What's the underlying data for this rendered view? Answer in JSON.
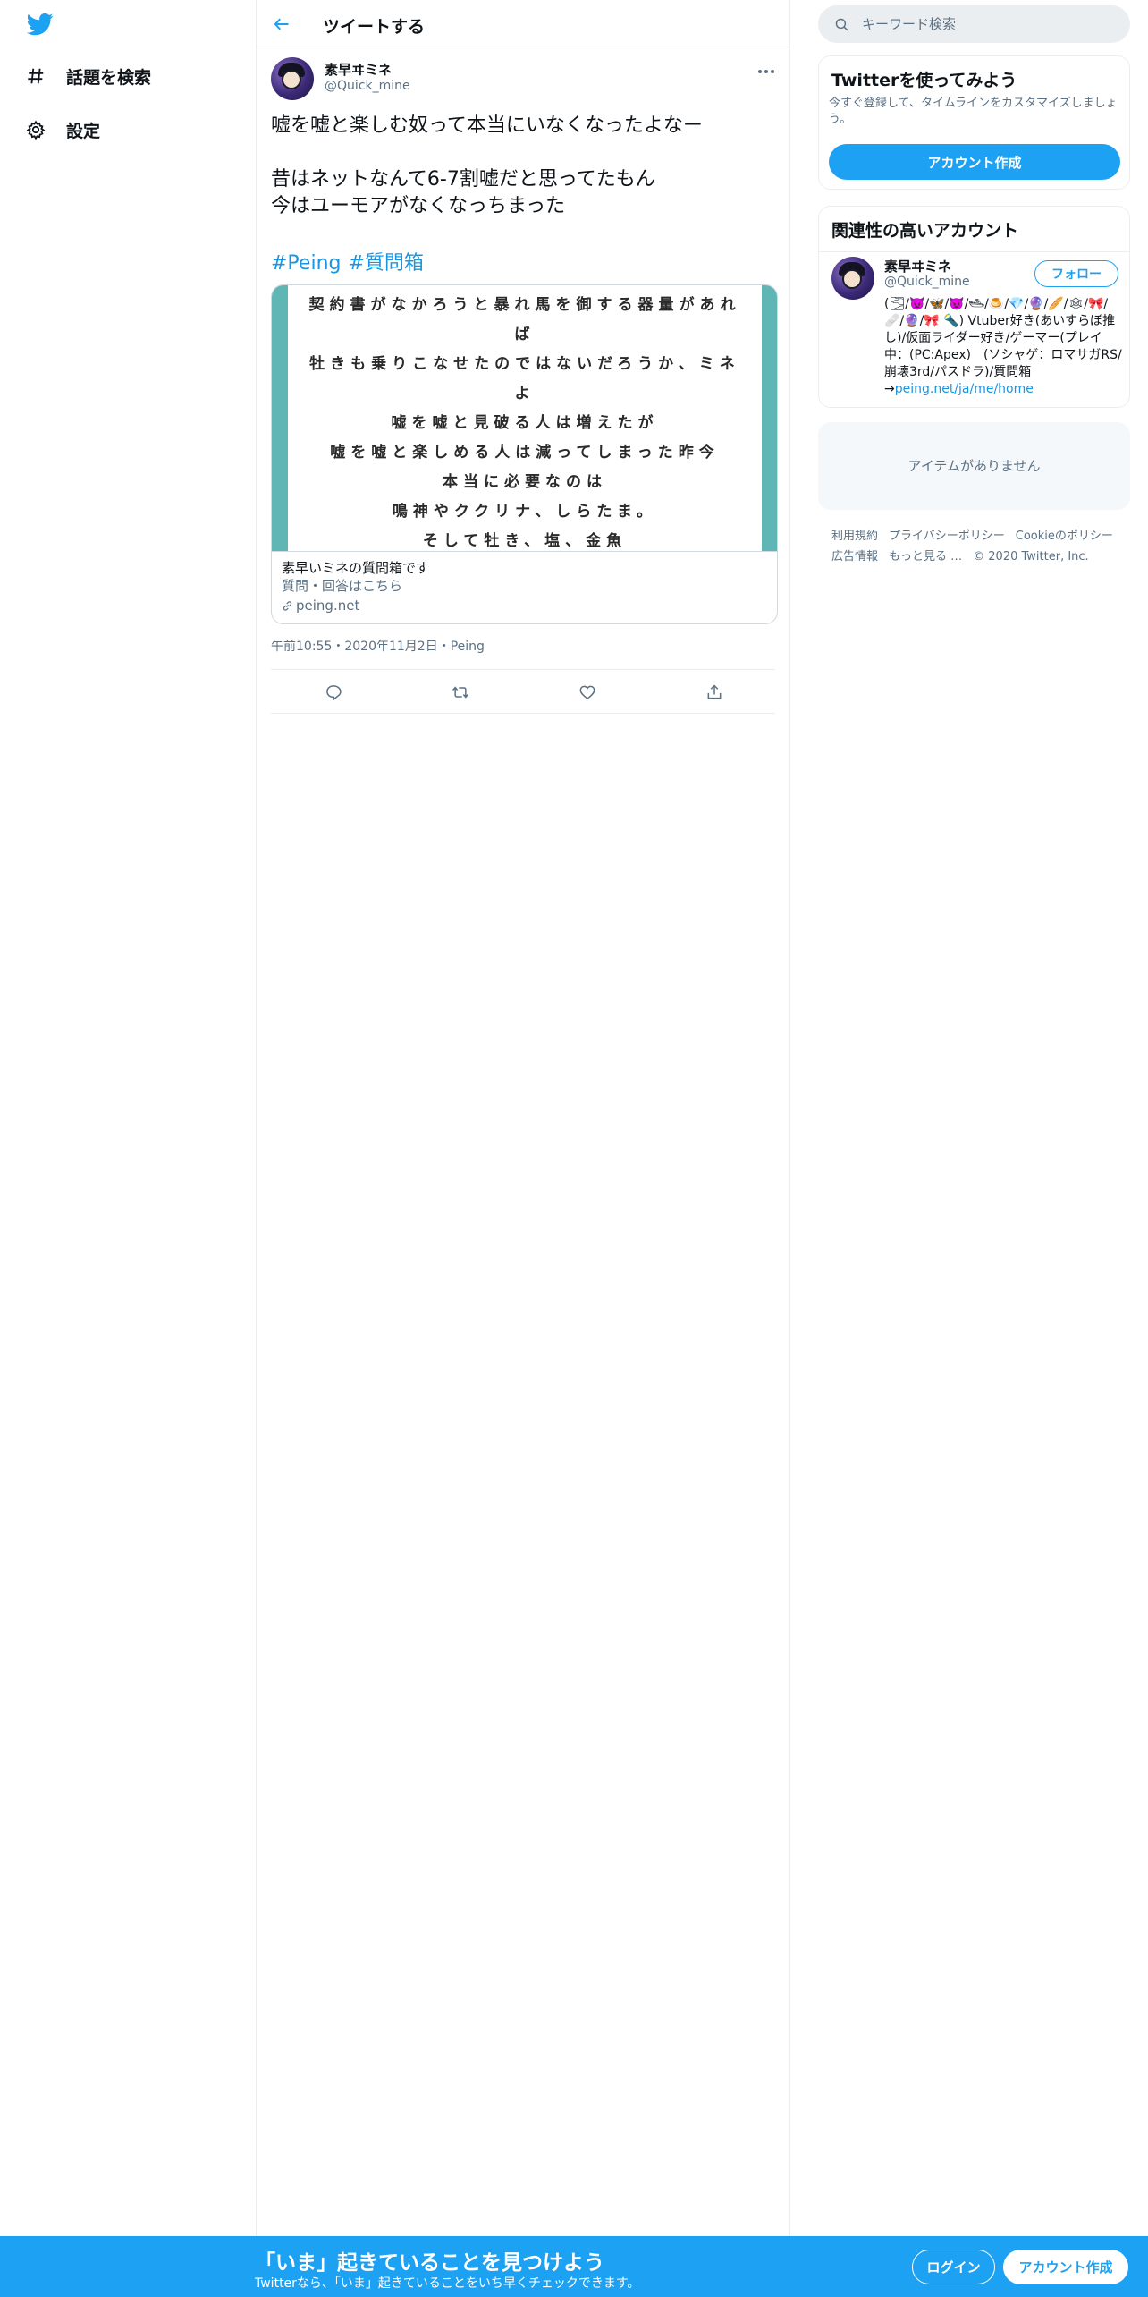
{
  "nav": {
    "logo_icon": "twitter-bird-icon",
    "explore_label": "話題を検索",
    "settings_label": "設定"
  },
  "header": {
    "title": "ツイートする"
  },
  "tweet": {
    "author_name": "素早ヰミネ",
    "author_handle": "@Quick_mine",
    "lines": [
      "嘘を嘘と楽しむ奴って本当にいなくなったよなー",
      "昔はネットなんて6-7割嘘だと思ってたもん",
      "今はユーモアがなくなっちまった"
    ],
    "hashtags": [
      "#Peing",
      "#質問箱"
    ],
    "timestamp": "午前10:55・2020年11月2日・Peing"
  },
  "card": {
    "image_lines": [
      "契約書がなかろうと暴れ馬を御する器量があれ",
      "ば",
      "牡きも乗りこなせたのではないだろうか、ミネ",
      "よ",
      "嘘を嘘と見破る人は増えたが",
      "嘘を嘘と楽しめる人は減ってしまった昨今",
      "本当に必要なのは",
      "鳴神やククリナ、しらたま。",
      "そして牡き、塩、金魚"
    ],
    "title": "素早いミネの質問箱です",
    "description": "質問・回答はこちら",
    "domain": "peing.net"
  },
  "search": {
    "placeholder": "キーワード検索"
  },
  "signup_panel": {
    "title": "Twitterを使ってみよう",
    "description": "今すぐ登録して、タイムラインをカスタマイズしましょう。",
    "button": "アカウント作成"
  },
  "related": {
    "title": "関連性の高いアカウント",
    "name": "素早ヰミネ",
    "handle": "@Quick_mine",
    "follow": "フォロー",
    "bio": "(🌫/👿/🦋/👿/🛥/🍮/💎/🔮/🥖/🕸/🎀/🩹/🔮/🎀 🔦) Vtuber好き(あいすらぼ推し)/仮面ライダー好き/ゲーマー(プレイ中：(PC:Apex)　(ソシャゲ：ロマサガRS/崩壊3rd/パスドラ)/質問箱→",
    "bio_link": "peing.net/ja/me/home"
  },
  "trends": {
    "empty": "アイテムがありません"
  },
  "footer": {
    "links": [
      "利用規約",
      "プライバシーポリシー",
      "Cookieのポリシー",
      "広告情報",
      "もっと見る …",
      "© 2020 Twitter, Inc."
    ]
  },
  "banner": {
    "title": "「いま」起きていることを見つけよう",
    "subtitle": "Twitterなら、「いま」起きていることをいち早くチェックできます。",
    "login": "ログイン",
    "signup": "アカウント作成"
  },
  "colors": {
    "accent": "#1da1f2",
    "link": "#1b95e0",
    "secondary_text": "#5b7083",
    "card_border_teal": "#5fb6b4"
  }
}
